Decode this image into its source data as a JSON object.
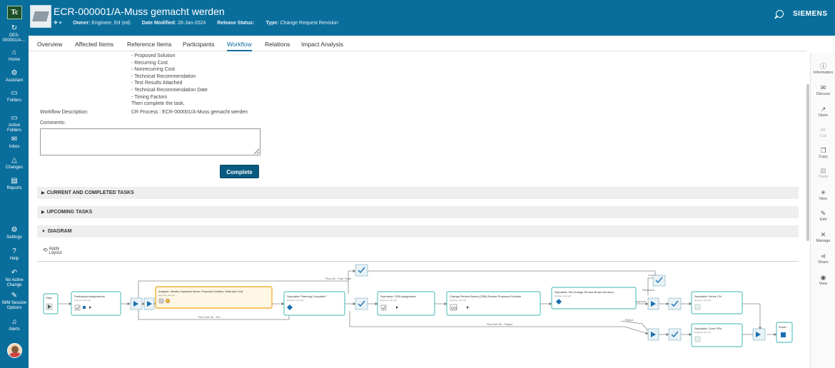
{
  "app": {
    "logo_text": "Tc",
    "brand": "SIEMENS"
  },
  "leftnav": [
    {
      "name": "nav-des",
      "icon": "↻",
      "label": "DES-\n000001/A-..."
    },
    {
      "name": "nav-home",
      "icon": "⌂",
      "label": "Home"
    },
    {
      "name": "nav-assistant",
      "icon": "⚙",
      "label": "Assistant"
    },
    {
      "name": "nav-folders",
      "icon": "▭",
      "label": "Folders"
    },
    {
      "name": "nav-active-folders",
      "icon": "▭",
      "label": "Active\nFolders"
    },
    {
      "name": "nav-inbox",
      "icon": "✉",
      "label": "Inbox"
    },
    {
      "name": "nav-changes",
      "icon": "△",
      "label": "Changes"
    },
    {
      "name": "nav-reports",
      "icon": "▤",
      "label": "Reports"
    },
    {
      "name": "nav-settings",
      "icon": "⚙",
      "label": "Settings"
    },
    {
      "name": "nav-help",
      "icon": "?",
      "label": "Help"
    },
    {
      "name": "nav-no-active-change",
      "icon": "↶",
      "label": "No Active\nChange"
    },
    {
      "name": "nav-imm-session",
      "icon": "✎",
      "label": "IMM Session\nOptions"
    },
    {
      "name": "nav-alerts",
      "icon": "♫",
      "label": "Alerts"
    }
  ],
  "header": {
    "title": "ECR-000001/A-Muss gemacht werden",
    "owner_label": "Owner:",
    "owner_value": "Engineer, Ed (ed)",
    "date_label": "Date Modified:",
    "date_value": "26-Jan-2024",
    "release_label": "Release Status:",
    "release_value": "",
    "type_label": "Type:",
    "type_value": "Change Request Revision"
  },
  "tabs": [
    "Overview",
    "Affected Items",
    "Reference Items",
    "Participants",
    "Workflow",
    "Relations",
    "Impact Analysis"
  ],
  "active_tab": "Workflow",
  "instructions": "- Proposed Solution\n- Recurring Cost\n- Nonrecurring Cost\n- Technical Recommendation\n- Test Results Attached\n- Technical Recommendation Date\n- Timing Factors\nThen complete the task.",
  "workflow": {
    "description_label": "Workflow Description:",
    "description_value": "CR Process : ECR-000001/A-Muss gemacht werden",
    "comments_label": "Comments:",
    "complete_label": "Complete"
  },
  "sections": {
    "current": "CURRENT AND COMPLETED TASKS",
    "upcoming": "UPCOMING TASKS",
    "diagram": "DIAGRAM"
  },
  "diagram": {
    "apply_layout": "Apply\nLayout",
    "nodes": {
      "start": "Start",
      "participant": "Participant Assignments",
      "analyze": "Analyze: Identify Impacted Items, Proposal Solution, Estimate Cost",
      "planning": "Specialist: Planning Complete?",
      "crb": "Specialist: CRB Assignment",
      "review": "Change Review Board (CRB) Review Proposed Solution",
      "decision": "Specialist: Set Change Review Board Decision",
      "derive": "Specialist: Derive CN",
      "close": "Specialist: Close PRs",
      "finish": "Finish"
    },
    "sub": "Engineer, Ed (ed)",
    "edges": {
      "plus_ok_fast": "Plus Ok - Fast Track",
      "plus_not_ok": "Plus Not Ok - Re...",
      "plus_not_ok_reject": "Plus Not Ok - Reject",
      "reject": "Reject",
      "research": "Research",
      "approve": "Approve"
    },
    "colors": {
      "task_border": "#5fc4c1",
      "active_border": "#f0b43a",
      "active_fill": "#fff7e6"
    }
  },
  "rightpanel": [
    {
      "name": "information",
      "icon": "ⓘ",
      "label": "Information",
      "dim": false
    },
    {
      "name": "discuss",
      "icon": "✉",
      "label": "Discuss",
      "dim": false
    },
    {
      "name": "open",
      "icon": "↗",
      "label": "Open",
      "dim": false
    },
    {
      "name": "cut",
      "icon": "✂",
      "label": "Cut",
      "dim": true
    },
    {
      "name": "copy",
      "icon": "❐",
      "label": "Copy",
      "dim": false
    },
    {
      "name": "paste",
      "icon": "▤",
      "label": "Paste",
      "dim": true
    },
    {
      "name": "new",
      "icon": "✳",
      "label": "New",
      "dim": false
    },
    {
      "name": "edit",
      "icon": "✎",
      "label": "Edit",
      "dim": false
    },
    {
      "name": "manage",
      "icon": "✕",
      "label": "Manage",
      "dim": false
    },
    {
      "name": "share",
      "icon": "⋖",
      "label": "Share",
      "dim": false
    },
    {
      "name": "view",
      "icon": "◉",
      "label": "View",
      "dim": false
    }
  ]
}
